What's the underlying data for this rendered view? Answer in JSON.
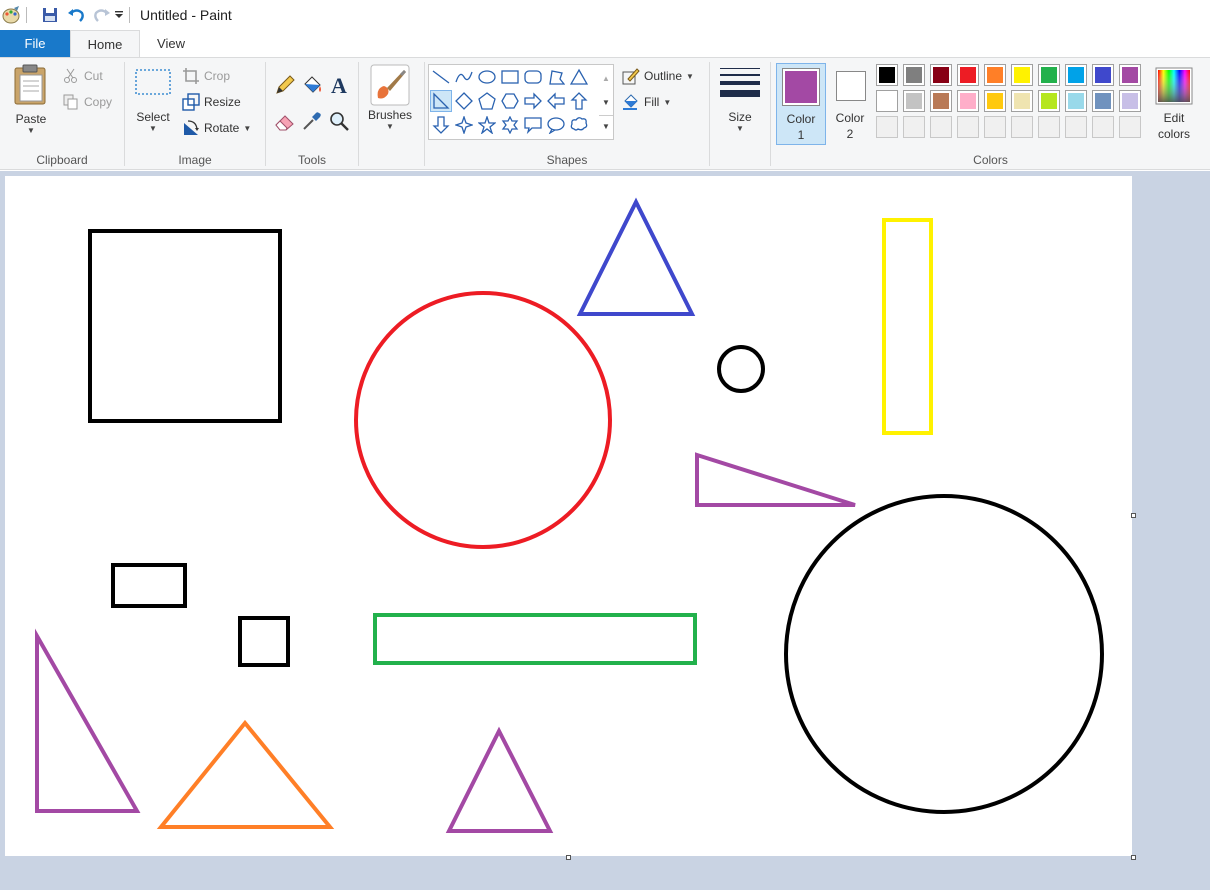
{
  "window": {
    "title": "Untitled - Paint"
  },
  "tabs": [
    {
      "label": "File"
    },
    {
      "label": "Home"
    },
    {
      "label": "View"
    }
  ],
  "clipboard": {
    "label": "Clipboard",
    "paste": "Paste",
    "cut": "Cut",
    "copy": "Copy"
  },
  "image": {
    "label": "Image",
    "select": "Select",
    "crop": "Crop",
    "resize": "Resize",
    "rotate": "Rotate"
  },
  "tools": {
    "label": "Tools"
  },
  "brushes": {
    "label": "Brushes"
  },
  "shapes": {
    "label": "Shapes",
    "outline": "Outline",
    "fill": "Fill"
  },
  "size": {
    "label": "Size"
  },
  "colors": {
    "label": "Colors",
    "color1_label": "Color 1",
    "color1_line1": "Color",
    "color1_line2": "1",
    "color2_line1": "Color",
    "color2_line2": "2",
    "edit_line1": "Edit",
    "edit_line2": "colors",
    "color1": "#a349a4",
    "color2": "#ffffff",
    "palette_row1": [
      "#000000",
      "#7f7f7f",
      "#880015",
      "#ed1c24",
      "#ff7f27",
      "#fff200",
      "#22b14c",
      "#00a2e8",
      "#3f48cc",
      "#a349a4"
    ],
    "palette_row2": [
      "#ffffff",
      "#c3c3c3",
      "#b97a57",
      "#ffaec9",
      "#ffc90e",
      "#efe4b0",
      "#b5e61d",
      "#99d9ea",
      "#7092be",
      "#c8bfe7"
    ],
    "palette_row3": [
      "#f0f0f0",
      "#f0f0f0",
      "#f0f0f0",
      "#f0f0f0",
      "#f0f0f0",
      "#f0f0f0",
      "#f0f0f0",
      "#f0f0f0",
      "#f0f0f0",
      "#f0f0f0"
    ]
  },
  "drawing": {
    "stroke_colors": {
      "black": "#000000",
      "red": "#ed1c24",
      "blue": "#3f48cc",
      "yellow": "#fff200",
      "purple": "#a349a4",
      "green": "#22b14c",
      "orange": "#ff7f27"
    }
  }
}
